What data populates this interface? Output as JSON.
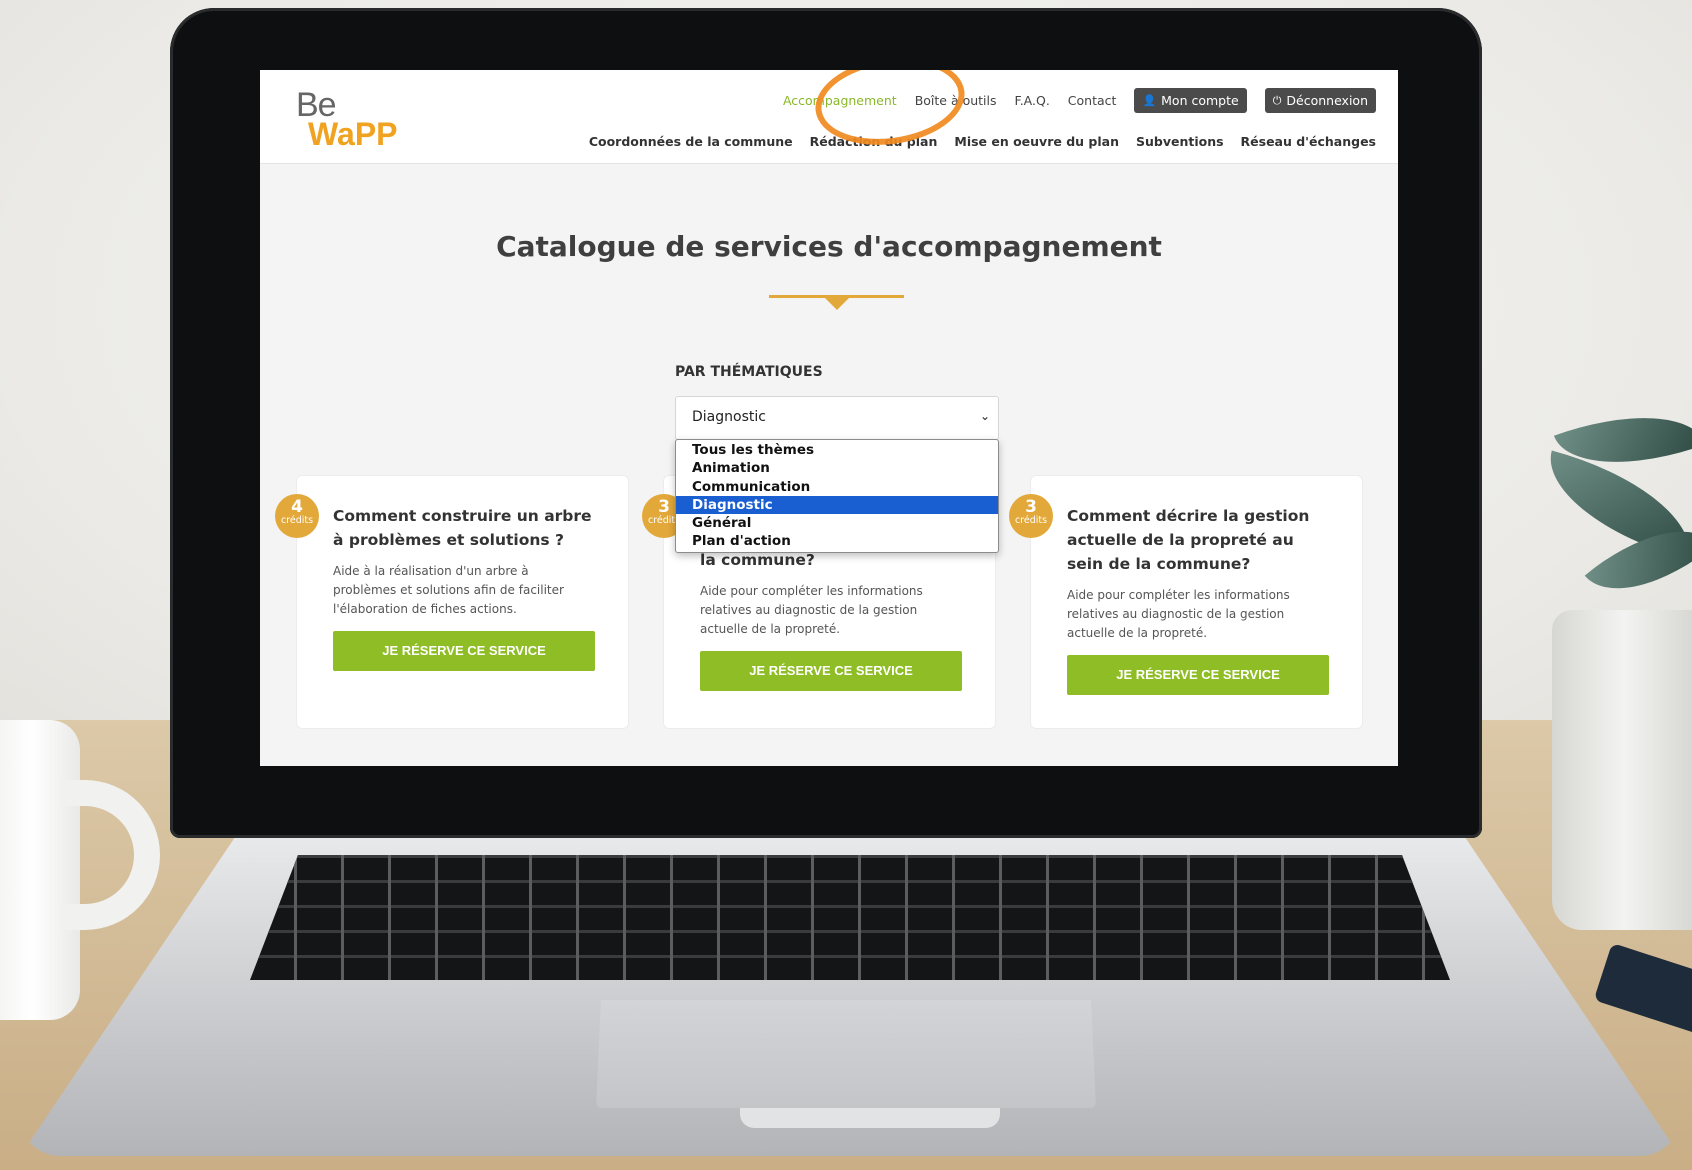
{
  "site": {
    "logo_be": "Be",
    "logo_wapp": "WaPP"
  },
  "topnav": {
    "items": [
      "Accompagnement",
      "Boîte à outils",
      "F.A.Q.",
      "Contact"
    ],
    "account_label": "Mon compte",
    "logout_label": "Déconnexion"
  },
  "mainnav": {
    "items": [
      "Coordonnées de la commune",
      "Rédaction du plan",
      "Mise en oeuvre du plan",
      "Subventions",
      "Réseau d'échanges"
    ]
  },
  "page": {
    "title": "Catalogue de services d'accompagnement"
  },
  "filter": {
    "label": "PAR THÉMATIQUES",
    "selected": "Diagnostic",
    "options": [
      "Tous les thèmes",
      "Animation",
      "Communication",
      "Diagnostic",
      "Général",
      "Plan d'action"
    ]
  },
  "cards": [
    {
      "credits": "4",
      "credits_unit": "crédits",
      "title": "Comment construire un arbre à problèmes et solutions ?",
      "description": "Aide à la réalisation d'un arbre à problèmes et solutions afin de faciliter l'élaboration de fiches actions.",
      "button": "JE RÉSERVE CE SERVICE"
    },
    {
      "credits": "3",
      "credits_unit": "crédits",
      "title": "la commune?",
      "description": "Aide pour compléter les informations relatives au diagnostic de la gestion actuelle de la propreté.",
      "button": "JE RÉSERVE CE SERVICE"
    },
    {
      "credits": "3",
      "credits_unit": "crédits",
      "title": "Comment décrire la gestion actuelle de la propreté au sein de la commune?",
      "description": "Aide pour compléter les informations relatives au diagnostic de la gestion actuelle de la propreté.",
      "button": "JE RÉSERVE CE SERVICE"
    }
  ],
  "colors": {
    "accent_orange": "#e3a83a",
    "brand_green": "#8fbd25",
    "highlight_circle": "#f08a1e",
    "selected_option": "#1a5fd1"
  }
}
